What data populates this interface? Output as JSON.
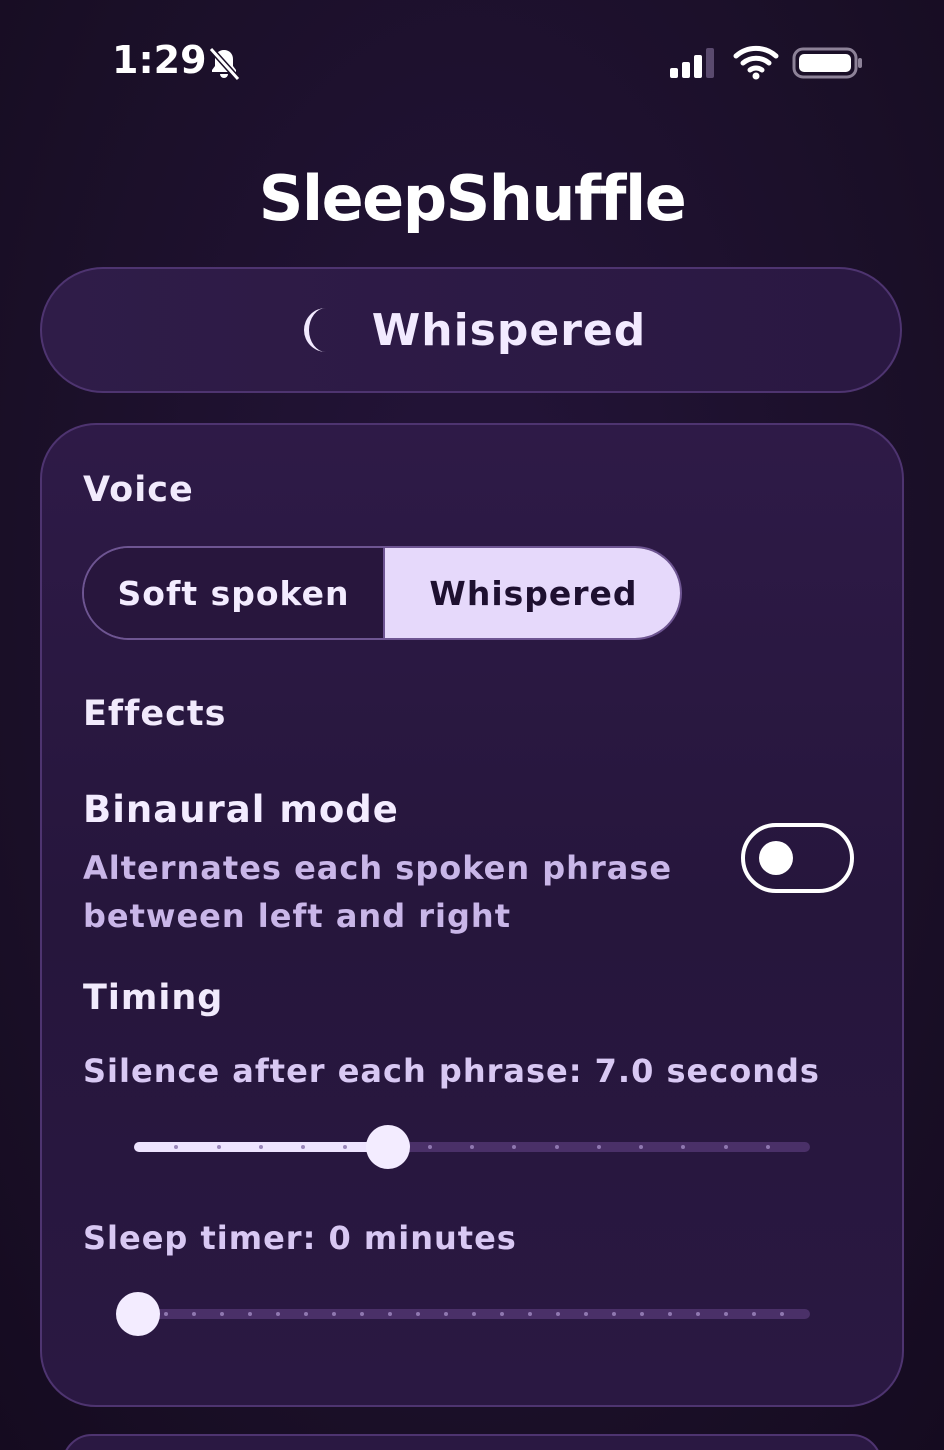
{
  "status_bar": {
    "time": "1:29",
    "mute_icon": "bell-slash-icon",
    "signal_icon": "cellular-signal-icon",
    "wifi_icon": "wifi-icon",
    "battery_icon": "battery-icon"
  },
  "app": {
    "title": "SleepShuffle"
  },
  "mode_banner": {
    "icon": "moon-icon",
    "label": "Whispered"
  },
  "settings": {
    "voice": {
      "heading": "Voice",
      "options": [
        "Soft spoken",
        "Whispered"
      ],
      "selected": "Whispered"
    },
    "effects": {
      "heading": "Effects",
      "binaural": {
        "title": "Binaural mode",
        "description": "Alternates each spoken phrase between left and right",
        "enabled": false
      }
    },
    "timing": {
      "heading": "Timing",
      "silence": {
        "label": "Silence after each phrase: 7.0 seconds",
        "value_fraction": 0.375,
        "tick_count": 17
      },
      "sleep_timer": {
        "label": "Sleep timer: 0 minutes",
        "value_fraction": 0.0,
        "tick_count": 25
      }
    }
  },
  "colors": {
    "background": "#1b0f27",
    "card": "#2a1842",
    "border": "#4e3470",
    "accent_light": "#e6d9fb",
    "muted_text": "#c9b6e8"
  }
}
